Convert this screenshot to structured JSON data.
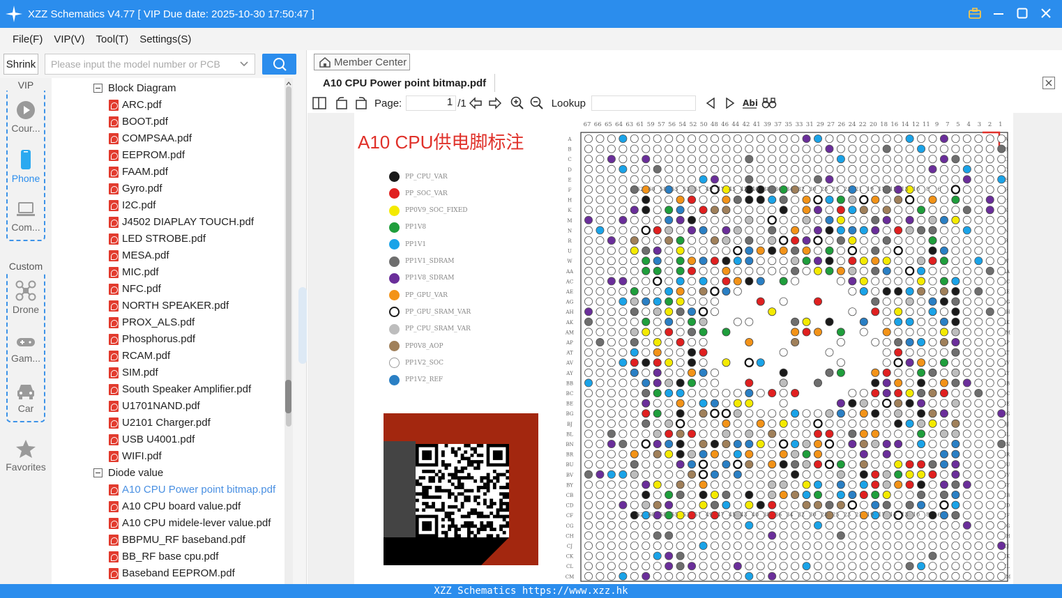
{
  "window": {
    "title": "XZZ Schematics V4.77 [ VIP Due date: 2025-10-30 17:50:47 ]"
  },
  "menu": [
    "File(F)",
    "VIP(V)",
    "Tool(T)",
    "Settings(S)"
  ],
  "search": {
    "shrink_label": "Shrink",
    "placeholder": "Please input the model number or PCB"
  },
  "rail": {
    "vip_label": "VIP",
    "custom_label": "Custom",
    "items": [
      {
        "label": "Cour...",
        "icon": "play-icon"
      },
      {
        "label": "Phone",
        "icon": "phone-icon",
        "active": true
      },
      {
        "label": "Com...",
        "icon": "laptop-icon"
      },
      {
        "label": "Drone",
        "icon": "drone-icon"
      },
      {
        "label": "Gam...",
        "icon": "gamepad-icon"
      },
      {
        "label": "Car",
        "icon": "car-icon"
      },
      {
        "label": "Favorites",
        "icon": "star-icon"
      }
    ]
  },
  "tree": {
    "folders": [
      {
        "label": "Block Diagram",
        "files": [
          "ARC.pdf",
          "BOOT.pdf",
          "COMPSAA.pdf",
          "EEPROM.pdf",
          "FAAM.pdf",
          "Gyro.pdf",
          "I2C.pdf",
          "J4502 DIAPLAY TOUCH.pdf",
          "LED STROBE.pdf",
          "MESA.pdf",
          "MIC.pdf",
          "NFC.pdf",
          "NORTH SPEAKER.pdf",
          "PROX_ALS.pdf",
          "Phosphorus.pdf",
          "RCAM.pdf",
          "SIM.pdf",
          "South Speaker Amplifier.pdf",
          "U1701NAND.pdf",
          "U2101 Charger.pdf",
          "USB U4001.pdf",
          "WIFI.pdf"
        ]
      },
      {
        "label": "Diode value",
        "files": [
          "A10 CPU Power point bitmap.pdf",
          "A10 CPU board value.pdf",
          "A10 CPU midele-lever value.pdf",
          "BBPMU_RF baseband.pdf",
          "BB_RF base cpu.pdf",
          "Baseband EEPROM.pdf"
        ]
      }
    ],
    "active_file": "A10 CPU Power point bitmap.pdf"
  },
  "main": {
    "member_center": "Member Center",
    "tab_title": "A10 CPU Power point bitmap.pdf",
    "page_label": "Page:",
    "page_value": "1",
    "page_total": "/1",
    "lookup_label": "Lookup"
  },
  "document": {
    "title": "A10 CPU供电脚标注",
    "legend": [
      {
        "label": "PP_CPU_VAR",
        "color": "#1a1a1a",
        "style": "fill"
      },
      {
        "label": "PP_SOC_VAR",
        "color": "#e02020",
        "style": "fill"
      },
      {
        "label": "PP0V9_SOC_FIXED",
        "color": "#f4ea00",
        "style": "fill"
      },
      {
        "label": "PP1V8",
        "color": "#1f9e3c",
        "style": "fill"
      },
      {
        "label": "PP1V1",
        "color": "#1aa3e8",
        "style": "fill"
      },
      {
        "label": "PP1V1_SDRAM",
        "color": "#6e6e6e",
        "style": "fill"
      },
      {
        "label": "PP1V8_SDRAM",
        "color": "#6a2e9a",
        "style": "fill"
      },
      {
        "label": "PP_GPU_VAR",
        "color": "#f39318",
        "style": "fill"
      },
      {
        "label": "PP_GPU_SRAM_VAR",
        "color": "#1a1a1a",
        "style": "ring"
      },
      {
        "label": "PP_CPU_SRAM_VAR",
        "color": "#bdbdbd",
        "style": "fill"
      },
      {
        "label": "PP0V8_AOP",
        "color": "#a0805a",
        "style": "fill"
      },
      {
        "label": "PP1V2_SOC",
        "color": "#999999",
        "style": "thin"
      },
      {
        "label": "PP1V2_REF",
        "color": "#2a7fc4",
        "style": "fill"
      }
    ],
    "grid": {
      "top_numbers": [
        "67",
        "66",
        "65",
        "64",
        "63",
        "61",
        "59",
        "57",
        "56",
        "54",
        "52",
        "50",
        "48",
        "46",
        "44",
        "42",
        "41",
        "39",
        "37",
        "35",
        "33",
        "31",
        "29",
        "27",
        "26",
        "24",
        "22",
        "20",
        "18",
        "16",
        "14",
        "12",
        "11",
        "9",
        "7",
        "5",
        "4",
        "3",
        "2",
        "1"
      ],
      "inner_numbers": [
        "62",
        "60",
        "58",
        "55",
        "53",
        "51",
        "49",
        "47",
        "45",
        "43",
        "40",
        "38",
        "36",
        "34",
        "32",
        "30",
        "28",
        "25",
        "23",
        "21",
        "19",
        "17",
        "15",
        "13",
        "10",
        "8",
        "6"
      ],
      "row_letters": [
        "A",
        "B",
        "C",
        "D",
        "E",
        "F",
        "H",
        "K",
        "M",
        "N",
        "R",
        "U",
        "W",
        "AA",
        "AC",
        "AE",
        "AG",
        "AH",
        "AK",
        "AM",
        "AP",
        "AT",
        "AV",
        "AY",
        "BB",
        "BC",
        "BE",
        "BG",
        "BJ",
        "BL",
        "BN",
        "BR",
        "BU",
        "BV",
        "BY",
        "CB",
        "CD",
        "CF",
        "CG",
        "CH",
        "CJ",
        "CK",
        "CL",
        "CM"
      ]
    }
  },
  "statusbar": "XZZ Schematics https://www.xzz.hk"
}
